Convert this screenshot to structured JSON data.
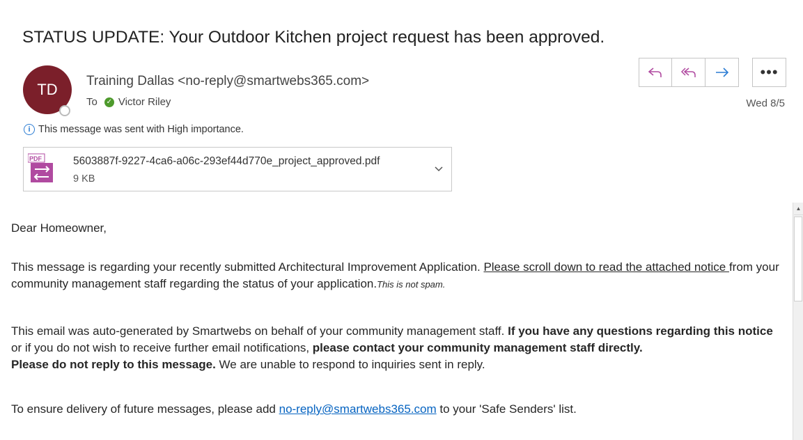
{
  "email": {
    "subject": "STATUS UPDATE: Your Outdoor Kitchen project request has been approved.",
    "sender": {
      "initials": "TD",
      "display": "Training Dallas <no-reply@smartwebs365.com>",
      "avatar_color": "#7b1f2a"
    },
    "to_label": "To",
    "recipient": "Victor Riley",
    "date": "Wed 8/5",
    "importance_note": "This message was sent with High importance."
  },
  "actions": {
    "reply_icon": "reply-icon",
    "reply_all_icon": "reply-all-icon",
    "forward_icon": "forward-icon",
    "more_icon": "more-icon"
  },
  "attachment": {
    "filename": "5603887f-9227-4ca6-a06c-293ef44d770e_project_approved.pdf",
    "size": "9 KB",
    "icon_label": "PDF"
  },
  "body": {
    "greeting": "Dear Homeowner,",
    "p2_part1": "This message is regarding your recently submitted Architectural Improvement Application. ",
    "p2_link_text": "Please scroll down to read the attached notice ",
    "p2_part2": "from your community management staff regarding the status of your application.",
    "p2_note": "This is not spam.",
    "p3_part1": "This email was auto-generated by Smartwebs on behalf of your community management staff. ",
    "p3_bold1": "If you have any questions regarding this notice",
    "p3_part2": " or if you do not wish to receive further email notifications, ",
    "p3_bold2": "please contact your community management staff directly.",
    "p3_bold3": "Please do not reply to this message.",
    "p3_part3": " We are unable to respond to inquiries sent in reply.",
    "p4_part1": "To ensure delivery of future messages, please add ",
    "p4_link": "no-reply@smartwebs365.com",
    "p4_part2": " to your 'Safe Senders' list."
  },
  "colors": {
    "accent": "#2b7cd3",
    "reply": "#b04aa0",
    "link": "#0563c1",
    "verified": "#4e9a2c"
  }
}
